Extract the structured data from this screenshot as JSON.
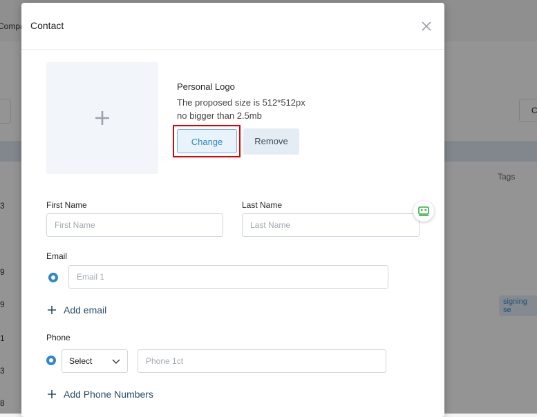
{
  "background": {
    "header_partial": "Compa",
    "right_button_partial": "C",
    "tags_header": "Tags",
    "tag_partial": "signing se",
    "row_digits": [
      "3",
      "9",
      "9",
      "1",
      "3",
      "8"
    ]
  },
  "dialog": {
    "title": "Contact",
    "close_icon": "close-icon",
    "logo": {
      "upload_icon": "plus-icon",
      "title": "Personal Logo",
      "hint_line1": "The proposed size is 512*512px",
      "hint_line2": "no bigger than 2.5mb",
      "change_label": "Change",
      "remove_label": "Remove"
    },
    "first_name": {
      "label": "First Name",
      "placeholder": "First Name",
      "value": ""
    },
    "last_name": {
      "label": "Last Name",
      "placeholder": "Last Name",
      "value": ""
    },
    "email": {
      "label": "Email",
      "placeholder": "Email 1",
      "value": ""
    },
    "add_email_label": "Add email",
    "phone": {
      "label": "Phone",
      "select_value": "Select",
      "placeholder": "Phone 1ct",
      "value": ""
    },
    "add_phone_label": "Add Phone Numbers"
  },
  "floating_widget_icon": "chat-bot-icon",
  "colors": {
    "accent": "#2f88c8",
    "highlight": "#e00000",
    "widget": "#2fae3d"
  }
}
